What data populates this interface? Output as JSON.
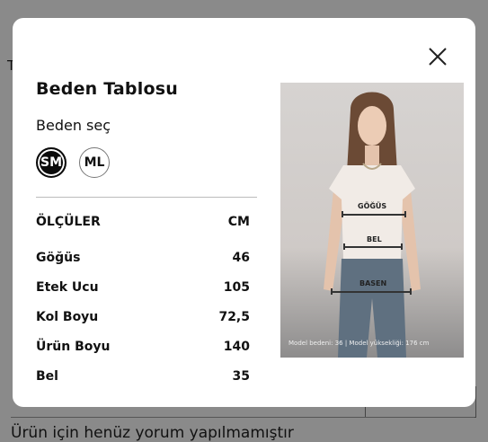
{
  "background": {
    "letter": "T",
    "footer_text": "Ürün için henüz yorum yapılmamıştır"
  },
  "modal": {
    "title": "Beden Tablosu",
    "subtitle": "Beden seç",
    "sizes": [
      "SM",
      "ML"
    ],
    "selected_size": "SM",
    "table": {
      "header": [
        "ÖLÇÜLER",
        "CM"
      ],
      "rows": [
        {
          "label": "Göğüs",
          "value": "46"
        },
        {
          "label": "Etek Ucu",
          "value": "105"
        },
        {
          "label": "Kol Boyu",
          "value": "72,5"
        },
        {
          "label": "Ürün Boyu",
          "value": "140"
        },
        {
          "label": "Bel",
          "value": "35"
        }
      ]
    },
    "image": {
      "labels": {
        "gogus": "GÖĞÜS",
        "bel": "BEL",
        "basen": "BASEN"
      },
      "caption": "Model bedeni: 36 | Model yüksekliği: 176 cm"
    }
  },
  "colors": {
    "overlay": "#8a8a8a",
    "modal_bg": "#ffffff",
    "selected": "#0b0b0b"
  }
}
